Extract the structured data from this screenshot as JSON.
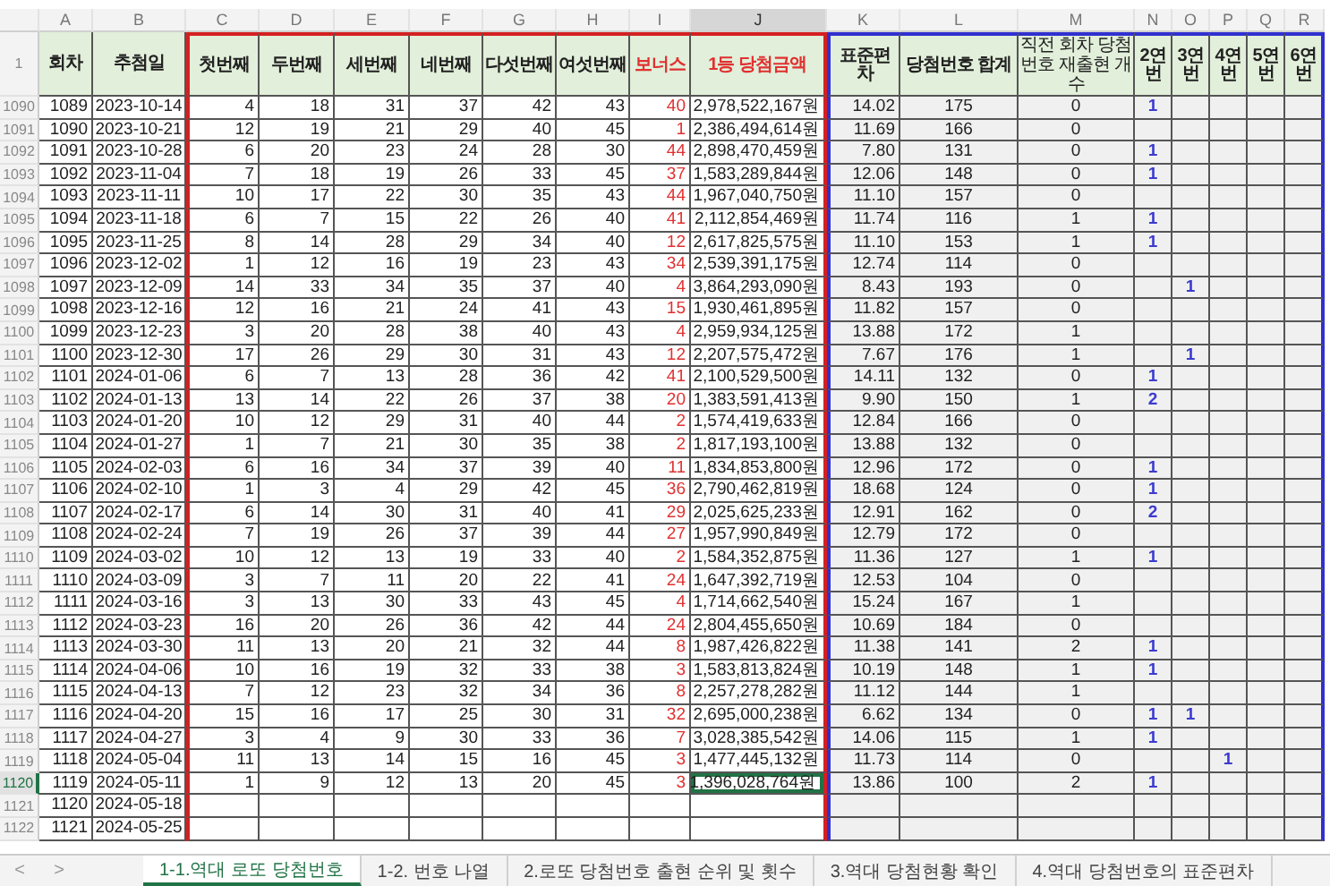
{
  "columns": [
    {
      "letter": "A",
      "title": "회차",
      "selected": false,
      "highlight": false
    },
    {
      "letter": "B",
      "title": "추첨일",
      "selected": false,
      "highlight": false
    },
    {
      "letter": "C",
      "title": "첫번째",
      "selected": false,
      "highlight": false
    },
    {
      "letter": "D",
      "title": "두번째",
      "selected": false,
      "highlight": false
    },
    {
      "letter": "E",
      "title": "세번째",
      "selected": false,
      "highlight": false
    },
    {
      "letter": "F",
      "title": "네번째",
      "selected": false,
      "highlight": false
    },
    {
      "letter": "G",
      "title": "다섯번째",
      "selected": false,
      "highlight": false
    },
    {
      "letter": "H",
      "title": "여섯번째",
      "selected": false,
      "highlight": false
    },
    {
      "letter": "I",
      "title": "보너스",
      "selected": false,
      "highlight": true
    },
    {
      "letter": "J",
      "title": "1등 당첨금액",
      "selected": true,
      "highlight": true
    },
    {
      "letter": "K",
      "title": "표준편차",
      "selected": false,
      "highlight": false
    },
    {
      "letter": "L",
      "title": "당첨번호 합계",
      "selected": false,
      "highlight": false
    },
    {
      "letter": "M",
      "title": "직전 회차 당첨번호 재출현 개수",
      "selected": false,
      "highlight": false
    },
    {
      "letter": "N",
      "title": "2연번",
      "selected": false,
      "highlight": false
    },
    {
      "letter": "O",
      "title": "3연번",
      "selected": false,
      "highlight": false
    },
    {
      "letter": "P",
      "title": "4연번",
      "selected": false,
      "highlight": false
    },
    {
      "letter": "Q",
      "title": "5연번",
      "selected": false,
      "highlight": false
    },
    {
      "letter": "R",
      "title": "6연번",
      "selected": false,
      "highlight": false
    }
  ],
  "header_row": "1",
  "rows": [
    {
      "row": "1090",
      "round": "1089",
      "date": "2023-10-14",
      "balls": [
        "4",
        "18",
        "31",
        "37",
        "42",
        "43"
      ],
      "bonus": "40",
      "prize": "2,978,522,167원",
      "std": "14.02",
      "sum": "175",
      "repeat": "0",
      "runs": {
        "2": "1"
      },
      "selected": false
    },
    {
      "row": "1091",
      "round": "1090",
      "date": "2023-10-21",
      "balls": [
        "12",
        "19",
        "21",
        "29",
        "40",
        "45"
      ],
      "bonus": "1",
      "prize": "2,386,494,614원",
      "std": "11.69",
      "sum": "166",
      "repeat": "0",
      "selected": false
    },
    {
      "row": "1092",
      "round": "1091",
      "date": "2023-10-28",
      "balls": [
        "6",
        "20",
        "23",
        "24",
        "28",
        "30"
      ],
      "bonus": "44",
      "prize": "2,898,470,459원",
      "std": "7.80",
      "sum": "131",
      "repeat": "0",
      "runs": {
        "2": "1"
      },
      "selected": false
    },
    {
      "row": "1093",
      "round": "1092",
      "date": "2023-11-04",
      "balls": [
        "7",
        "18",
        "19",
        "26",
        "33",
        "45"
      ],
      "bonus": "37",
      "prize": "1,583,289,844원",
      "std": "12.06",
      "sum": "148",
      "repeat": "0",
      "runs": {
        "2": "1"
      },
      "selected": false
    },
    {
      "row": "1094",
      "round": "1093",
      "date": "2023-11-11",
      "balls": [
        "10",
        "17",
        "22",
        "30",
        "35",
        "43"
      ],
      "bonus": "44",
      "prize": "1,967,040,750원",
      "std": "11.10",
      "sum": "157",
      "repeat": "0",
      "selected": false
    },
    {
      "row": "1095",
      "round": "1094",
      "date": "2023-11-18",
      "balls": [
        "6",
        "7",
        "15",
        "22",
        "26",
        "40"
      ],
      "bonus": "41",
      "prize": "2,112,854,469원",
      "std": "11.74",
      "sum": "116",
      "repeat": "1",
      "runs": {
        "2": "1"
      },
      "selected": false
    },
    {
      "row": "1096",
      "round": "1095",
      "date": "2023-11-25",
      "balls": [
        "8",
        "14",
        "28",
        "29",
        "34",
        "40"
      ],
      "bonus": "12",
      "prize": "2,617,825,575원",
      "std": "11.10",
      "sum": "153",
      "repeat": "1",
      "runs": {
        "2": "1"
      },
      "selected": false
    },
    {
      "row": "1097",
      "round": "1096",
      "date": "2023-12-02",
      "balls": [
        "1",
        "12",
        "16",
        "19",
        "23",
        "43"
      ],
      "bonus": "34",
      "prize": "2,539,391,175원",
      "std": "12.74",
      "sum": "114",
      "repeat": "0",
      "selected": false
    },
    {
      "row": "1098",
      "round": "1097",
      "date": "2023-12-09",
      "balls": [
        "14",
        "33",
        "34",
        "35",
        "37",
        "40"
      ],
      "bonus": "4",
      "prize": "3,864,293,090원",
      "std": "8.43",
      "sum": "193",
      "repeat": "0",
      "runs": {
        "3": "1"
      },
      "selected": false
    },
    {
      "row": "1099",
      "round": "1098",
      "date": "2023-12-16",
      "balls": [
        "12",
        "16",
        "21",
        "24",
        "41",
        "43"
      ],
      "bonus": "15",
      "prize": "1,930,461,895원",
      "std": "11.82",
      "sum": "157",
      "repeat": "0",
      "selected": false
    },
    {
      "row": "1100",
      "round": "1099",
      "date": "2023-12-23",
      "balls": [
        "3",
        "20",
        "28",
        "38",
        "40",
        "43"
      ],
      "bonus": "4",
      "prize": "2,959,934,125원",
      "std": "13.88",
      "sum": "172",
      "repeat": "1",
      "selected": false
    },
    {
      "row": "1101",
      "round": "1100",
      "date": "2023-12-30",
      "balls": [
        "17",
        "26",
        "29",
        "30",
        "31",
        "43"
      ],
      "bonus": "12",
      "prize": "2,207,575,472원",
      "std": "7.67",
      "sum": "176",
      "repeat": "1",
      "runs": {
        "3": "1"
      },
      "selected": false
    },
    {
      "row": "1102",
      "round": "1101",
      "date": "2024-01-06",
      "balls": [
        "6",
        "7",
        "13",
        "28",
        "36",
        "42"
      ],
      "bonus": "41",
      "prize": "2,100,529,500원",
      "std": "14.11",
      "sum": "132",
      "repeat": "0",
      "runs": {
        "2": "1"
      },
      "selected": false
    },
    {
      "row": "1103",
      "round": "1102",
      "date": "2024-01-13",
      "balls": [
        "13",
        "14",
        "22",
        "26",
        "37",
        "38"
      ],
      "bonus": "20",
      "prize": "1,383,591,413원",
      "std": "9.90",
      "sum": "150",
      "repeat": "1",
      "runs": {
        "2": "2"
      },
      "selected": false
    },
    {
      "row": "1104",
      "round": "1103",
      "date": "2024-01-20",
      "balls": [
        "10",
        "12",
        "29",
        "31",
        "40",
        "44"
      ],
      "bonus": "2",
      "prize": "1,574,419,633원",
      "std": "12.84",
      "sum": "166",
      "repeat": "0",
      "selected": false
    },
    {
      "row": "1105",
      "round": "1104",
      "date": "2024-01-27",
      "balls": [
        "1",
        "7",
        "21",
        "30",
        "35",
        "38"
      ],
      "bonus": "2",
      "prize": "1,817,193,100원",
      "std": "13.88",
      "sum": "132",
      "repeat": "0",
      "selected": false
    },
    {
      "row": "1106",
      "round": "1105",
      "date": "2024-02-03",
      "balls": [
        "6",
        "16",
        "34",
        "37",
        "39",
        "40"
      ],
      "bonus": "11",
      "prize": "1,834,853,800원",
      "std": "12.96",
      "sum": "172",
      "repeat": "0",
      "runs": {
        "2": "1"
      },
      "selected": false
    },
    {
      "row": "1107",
      "round": "1106",
      "date": "2024-02-10",
      "balls": [
        "1",
        "3",
        "4",
        "29",
        "42",
        "45"
      ],
      "bonus": "36",
      "prize": "2,790,462,819원",
      "std": "18.68",
      "sum": "124",
      "repeat": "0",
      "runs": {
        "2": "1"
      },
      "selected": false
    },
    {
      "row": "1108",
      "round": "1107",
      "date": "2024-02-17",
      "balls": [
        "6",
        "14",
        "30",
        "31",
        "40",
        "41"
      ],
      "bonus": "29",
      "prize": "2,025,625,233원",
      "std": "12.91",
      "sum": "162",
      "repeat": "0",
      "runs": {
        "2": "2"
      },
      "selected": false
    },
    {
      "row": "1109",
      "round": "1108",
      "date": "2024-02-24",
      "balls": [
        "7",
        "19",
        "26",
        "37",
        "39",
        "44"
      ],
      "bonus": "27",
      "prize": "1,957,990,849원",
      "std": "12.79",
      "sum": "172",
      "repeat": "0",
      "selected": false
    },
    {
      "row": "1110",
      "round": "1109",
      "date": "2024-03-02",
      "balls": [
        "10",
        "12",
        "13",
        "19",
        "33",
        "40"
      ],
      "bonus": "2",
      "prize": "1,584,352,875원",
      "std": "11.36",
      "sum": "127",
      "repeat": "1",
      "runs": {
        "2": "1"
      },
      "selected": false
    },
    {
      "row": "1111",
      "round": "1110",
      "date": "2024-03-09",
      "balls": [
        "3",
        "7",
        "11",
        "20",
        "22",
        "41"
      ],
      "bonus": "24",
      "prize": "1,647,392,719원",
      "std": "12.53",
      "sum": "104",
      "repeat": "0",
      "selected": false
    },
    {
      "row": "1112",
      "round": "1111",
      "date": "2024-03-16",
      "balls": [
        "3",
        "13",
        "30",
        "33",
        "43",
        "45"
      ],
      "bonus": "4",
      "prize": "1,714,662,540원",
      "std": "15.24",
      "sum": "167",
      "repeat": "1",
      "selected": false
    },
    {
      "row": "1113",
      "round": "1112",
      "date": "2024-03-23",
      "balls": [
        "16",
        "20",
        "26",
        "36",
        "42",
        "44"
      ],
      "bonus": "24",
      "prize": "2,804,455,650원",
      "std": "10.69",
      "sum": "184",
      "repeat": "0",
      "selected": false
    },
    {
      "row": "1114",
      "round": "1113",
      "date": "2024-03-30",
      "balls": [
        "11",
        "13",
        "20",
        "21",
        "32",
        "44"
      ],
      "bonus": "8",
      "prize": "1,987,426,822원",
      "std": "11.38",
      "sum": "141",
      "repeat": "2",
      "runs": {
        "2": "1"
      },
      "selected": false
    },
    {
      "row": "1115",
      "round": "1114",
      "date": "2024-04-06",
      "balls": [
        "10",
        "16",
        "19",
        "32",
        "33",
        "38"
      ],
      "bonus": "3",
      "prize": "1,583,813,824원",
      "std": "10.19",
      "sum": "148",
      "repeat": "1",
      "runs": {
        "2": "1"
      },
      "selected": false
    },
    {
      "row": "1116",
      "round": "1115",
      "date": "2024-04-13",
      "balls": [
        "7",
        "12",
        "23",
        "32",
        "34",
        "36"
      ],
      "bonus": "8",
      "prize": "2,257,278,282원",
      "std": "11.12",
      "sum": "144",
      "repeat": "1",
      "selected": false
    },
    {
      "row": "1117",
      "round": "1116",
      "date": "2024-04-20",
      "balls": [
        "15",
        "16",
        "17",
        "25",
        "30",
        "31"
      ],
      "bonus": "32",
      "prize": "2,695,000,238원",
      "std": "6.62",
      "sum": "134",
      "repeat": "0",
      "runs": {
        "2": "1",
        "3": "1"
      },
      "selected": false
    },
    {
      "row": "1118",
      "round": "1117",
      "date": "2024-04-27",
      "balls": [
        "3",
        "4",
        "9",
        "30",
        "33",
        "36"
      ],
      "bonus": "7",
      "prize": "3,028,385,542원",
      "std": "14.06",
      "sum": "115",
      "repeat": "1",
      "runs": {
        "2": "1"
      },
      "selected": false
    },
    {
      "row": "1119",
      "round": "1118",
      "date": "2024-05-04",
      "balls": [
        "11",
        "13",
        "14",
        "15",
        "16",
        "45"
      ],
      "bonus": "3",
      "prize": "1,477,445,132원",
      "std": "11.73",
      "sum": "114",
      "repeat": "0",
      "runs": {
        "4": "1"
      },
      "selected": false
    },
    {
      "row": "1120",
      "round": "1119",
      "date": "2024-05-11",
      "balls": [
        "1",
        "9",
        "12",
        "13",
        "20",
        "45"
      ],
      "bonus": "3",
      "prize": "1,396,028,764원",
      "std": "13.86",
      "sum": "100",
      "repeat": "2",
      "runs": {
        "2": "1"
      },
      "selected": true
    },
    {
      "row": "1121",
      "round": "1120",
      "date": "2024-05-18",
      "selected": false
    },
    {
      "row": "1122",
      "round": "1121",
      "date": "2024-05-25",
      "selected": false
    }
  ],
  "sheet_nav": [
    "<",
    ">"
  ],
  "sheet_tabs": [
    {
      "label": "1-1.역대 로또 당첨번호",
      "selected": true
    },
    {
      "label": "1-2. 번호 나열",
      "selected": false
    },
    {
      "label": "2.로또 당첨번호 출현 순위 및 횟수",
      "selected": false
    },
    {
      "label": "3.역대 당첨현황 확인",
      "selected": false
    },
    {
      "label": "4.역대 당첨번호의 표준편차",
      "selected": false
    }
  ]
}
